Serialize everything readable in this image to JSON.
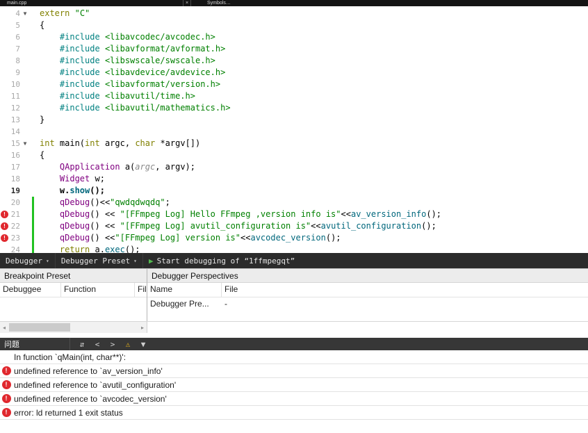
{
  "topbar": {
    "file_label": "main.cpp",
    "close_glyph": "×",
    "symbol_label": "Symbols…"
  },
  "editor": {
    "fold_glyph": "▼",
    "error_glyph": "!",
    "change_bar_color": "#21c221",
    "lines": [
      {
        "n": 4,
        "fold": true,
        "t": [
          [
            "kw",
            "extern"
          ],
          [
            "pl",
            " "
          ],
          [
            "str",
            "\"C\""
          ]
        ]
      },
      {
        "n": 5,
        "t": [
          [
            "pl",
            "{"
          ]
        ]
      },
      {
        "n": 6,
        "t": [
          [
            "pl",
            "    "
          ],
          [
            "pp",
            "#include"
          ],
          [
            "pl",
            " "
          ],
          [
            "inc",
            "<libavcodec/avcodec.h>"
          ]
        ]
      },
      {
        "n": 7,
        "t": [
          [
            "pl",
            "    "
          ],
          [
            "pp",
            "#include"
          ],
          [
            "pl",
            " "
          ],
          [
            "inc",
            "<libavformat/avformat.h>"
          ]
        ]
      },
      {
        "n": 8,
        "t": [
          [
            "pl",
            "    "
          ],
          [
            "pp",
            "#include"
          ],
          [
            "pl",
            " "
          ],
          [
            "inc",
            "<libswscale/swscale.h>"
          ]
        ]
      },
      {
        "n": 9,
        "t": [
          [
            "pl",
            "    "
          ],
          [
            "pp",
            "#include"
          ],
          [
            "pl",
            " "
          ],
          [
            "inc",
            "<libavdevice/avdevice.h>"
          ]
        ]
      },
      {
        "n": 10,
        "t": [
          [
            "pl",
            "    "
          ],
          [
            "pp",
            "#include"
          ],
          [
            "pl",
            " "
          ],
          [
            "inc",
            "<libavformat/version.h>"
          ]
        ]
      },
      {
        "n": 11,
        "t": [
          [
            "pl",
            "    "
          ],
          [
            "pp",
            "#include"
          ],
          [
            "pl",
            " "
          ],
          [
            "inc",
            "<libavutil/time.h>"
          ]
        ]
      },
      {
        "n": 12,
        "t": [
          [
            "pl",
            "    "
          ],
          [
            "pp",
            "#include"
          ],
          [
            "pl",
            " "
          ],
          [
            "inc",
            "<libavutil/mathematics.h>"
          ]
        ]
      },
      {
        "n": 13,
        "t": [
          [
            "pl",
            "}"
          ]
        ]
      },
      {
        "n": 14,
        "t": []
      },
      {
        "n": 15,
        "fold": true,
        "t": [
          [
            "kw",
            "int"
          ],
          [
            "pl",
            " main("
          ],
          [
            "kw",
            "int"
          ],
          [
            "pl",
            " argc, "
          ],
          [
            "kw",
            "char"
          ],
          [
            "pl",
            " *argv[])"
          ]
        ]
      },
      {
        "n": 16,
        "t": [
          [
            "pl",
            "{"
          ]
        ]
      },
      {
        "n": 17,
        "t": [
          [
            "pl",
            "    "
          ],
          [
            "type",
            "QApplication"
          ],
          [
            "pl",
            " a("
          ],
          [
            "param",
            "argc"
          ],
          [
            "pl",
            ", argv);"
          ]
        ]
      },
      {
        "n": 18,
        "t": [
          [
            "pl",
            "    "
          ],
          [
            "type",
            "Widget"
          ],
          [
            "pl",
            " w;"
          ]
        ]
      },
      {
        "n": 19,
        "bold": true,
        "t": [
          [
            "pl",
            "    w."
          ],
          [
            "fn",
            "show"
          ],
          [
            "pl",
            "();"
          ]
        ]
      },
      {
        "n": 20,
        "chg": true,
        "t": [
          [
            "pl",
            "    "
          ],
          [
            "type",
            "qDebug"
          ],
          [
            "pl",
            "()<<"
          ],
          [
            "str",
            "\"qwdqdwqdq\""
          ],
          [
            "pl",
            ";"
          ]
        ]
      },
      {
        "n": 21,
        "err": true,
        "chg": true,
        "t": [
          [
            "pl",
            "    "
          ],
          [
            "type",
            "qDebug"
          ],
          [
            "pl",
            "() << "
          ],
          [
            "str",
            "\"[FFmpeg Log] Hello FFmpeg ,version info is\""
          ],
          [
            "pl",
            "<<"
          ],
          [
            "fn",
            "av_version_info"
          ],
          [
            "pl",
            "();"
          ]
        ]
      },
      {
        "n": 22,
        "err": true,
        "chg": true,
        "t": [
          [
            "pl",
            "    "
          ],
          [
            "type",
            "qDebug"
          ],
          [
            "pl",
            "() << "
          ],
          [
            "str",
            "\"[FFmpeg Log] avutil_configuration is\""
          ],
          [
            "pl",
            "<<"
          ],
          [
            "fn",
            "avutil_configuration"
          ],
          [
            "pl",
            "();"
          ]
        ]
      },
      {
        "n": 23,
        "err": true,
        "chg": true,
        "t": [
          [
            "pl",
            "    "
          ],
          [
            "type",
            "qDebug"
          ],
          [
            "pl",
            "() <<"
          ],
          [
            "str",
            "\"[FFmpeg Log] version is\""
          ],
          [
            "pl",
            "<<"
          ],
          [
            "fn",
            "avcodec_version"
          ],
          [
            "pl",
            "();"
          ]
        ]
      },
      {
        "n": 24,
        "chg": true,
        "t": [
          [
            "pl",
            "    "
          ],
          [
            "kw",
            "return"
          ],
          [
            "pl",
            " a."
          ],
          [
            "fn",
            "exec"
          ],
          [
            "pl",
            "();"
          ]
        ]
      }
    ]
  },
  "debug_toolbar": {
    "debugger_label": "Debugger",
    "preset_label": "Debugger Preset",
    "caret": "▾",
    "play_glyph": "▶",
    "start_label": "Start debugging of “1ffmpegqt”"
  },
  "panels": {
    "breakpoint": {
      "title": "Breakpoint Preset",
      "columns": [
        "Debuggee",
        "Function",
        "File"
      ]
    },
    "perspectives": {
      "title": "Debugger Perspectives",
      "columns": [
        "Name",
        "File"
      ],
      "row": [
        "Debugger Pre...",
        "-"
      ]
    }
  },
  "scrollbar": {
    "left_arrow": "◂",
    "right_arrow": "▸"
  },
  "issues": {
    "title": "问题",
    "error_glyph": "!",
    "error_color": "#e0282e",
    "warning_color": "#e8b31a",
    "toolbar_icons": [
      {
        "name": "sort-icon",
        "glyph": "⇵"
      },
      {
        "name": "prev-issue-icon",
        "glyph": "<"
      },
      {
        "name": "next-issue-icon",
        "glyph": ">"
      },
      {
        "name": "warnings-toggle-icon",
        "glyph": "⚠"
      },
      {
        "name": "filter-icon",
        "glyph": "▼"
      }
    ],
    "items": [
      {
        "icon": false,
        "text": "In function `qMain(int, char**)':"
      },
      {
        "icon": true,
        "text": "undefined reference to `av_version_info'"
      },
      {
        "icon": true,
        "text": "undefined reference to `avutil_configuration'"
      },
      {
        "icon": true,
        "text": "undefined reference to `avcodec_version'"
      },
      {
        "icon": true,
        "text": "error: ld returned 1 exit status"
      }
    ]
  }
}
